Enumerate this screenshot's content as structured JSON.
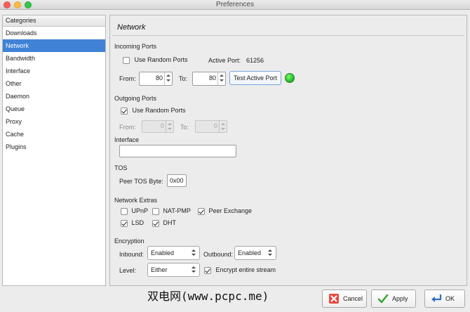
{
  "window": {
    "title": "Preferences"
  },
  "sidebar": {
    "header": "Categories",
    "items": [
      {
        "label": "Downloads"
      },
      {
        "label": "Network"
      },
      {
        "label": "Bandwidth"
      },
      {
        "label": "Interface"
      },
      {
        "label": "Other"
      },
      {
        "label": "Daemon"
      },
      {
        "label": "Queue"
      },
      {
        "label": "Proxy"
      },
      {
        "label": "Cache"
      },
      {
        "label": "Plugins"
      }
    ],
    "selected": "Network"
  },
  "panel": {
    "title": "Network",
    "incoming": {
      "section": "Incoming Ports",
      "use_random_label": "Use Random Ports",
      "use_random_checked": false,
      "active_port_label": "Active Port:",
      "active_port_value": "61256",
      "from_label": "From:",
      "from_value": "80",
      "to_label": "To:",
      "to_value": "80",
      "test_button": "Test Active Port",
      "status_color": "#2bb72b"
    },
    "outgoing": {
      "section": "Outgoing Ports",
      "use_random_label": "Use Random Ports",
      "use_random_checked": true,
      "from_label": "From:",
      "from_value": "0",
      "to_label": "To:",
      "to_value": "0"
    },
    "interface": {
      "section": "Interface",
      "value": ""
    },
    "tos": {
      "section": "TOS",
      "peer_label": "Peer TOS Byte:",
      "peer_value": "0x00"
    },
    "extras": {
      "section": "Network Extras",
      "upnp": "UPnP",
      "upnp_checked": false,
      "natpmp": "NAT-PMP",
      "natpmp_checked": false,
      "peer_exchange": "Peer Exchange",
      "peer_exchange_checked": true,
      "lsd": "LSD",
      "lsd_checked": true,
      "dht": "DHT",
      "dht_checked": true
    },
    "encryption": {
      "section": "Encryption",
      "inbound_label": "Inbound:",
      "inbound_value": "Enabled",
      "outbound_label": "Outbound:",
      "outbound_value": "Enabled",
      "level_label": "Level:",
      "level_value": "Either",
      "encrypt_stream_label": "Encrypt entire stream",
      "encrypt_stream_checked": true
    }
  },
  "footer": {
    "cancel": "Cancel",
    "apply": "Apply",
    "ok": "OK",
    "watermark": "双电网(www.pcpc.me)"
  }
}
